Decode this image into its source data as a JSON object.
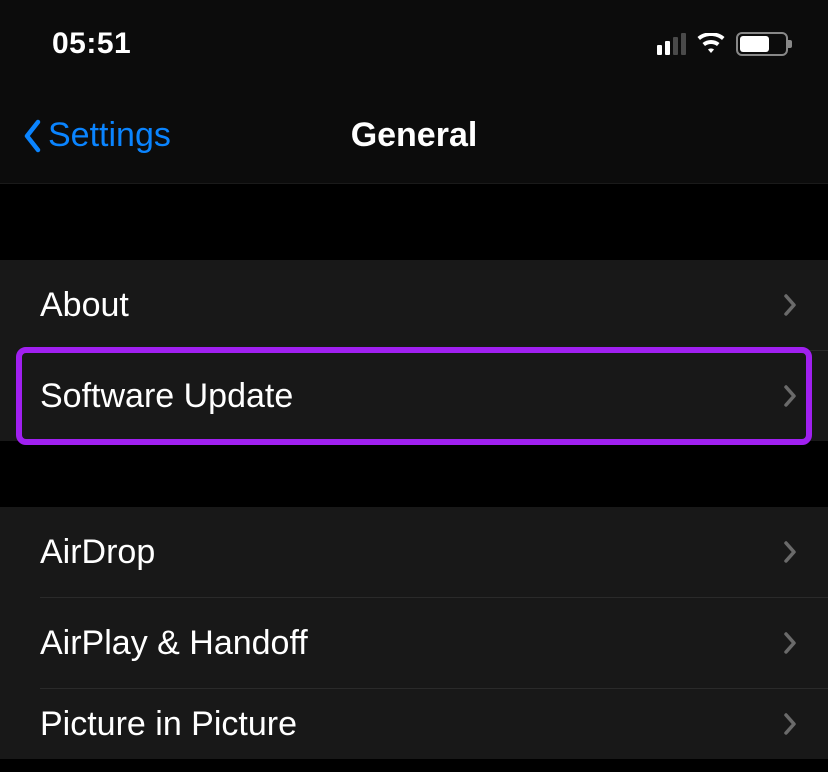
{
  "status": {
    "time": "05:51"
  },
  "nav": {
    "back_label": "Settings",
    "title": "General"
  },
  "section1": {
    "items": [
      {
        "label": "About"
      },
      {
        "label": "Software Update"
      }
    ]
  },
  "section2": {
    "items": [
      {
        "label": "AirDrop"
      },
      {
        "label": "AirPlay & Handoff"
      },
      {
        "label": "Picture in Picture"
      }
    ]
  },
  "colors": {
    "accent": "#0a84ff",
    "highlight": "#a020f0"
  }
}
